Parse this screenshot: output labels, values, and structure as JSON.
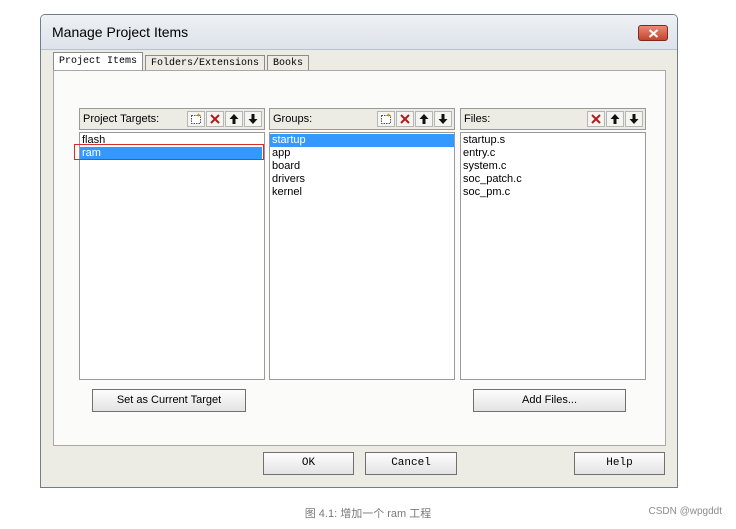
{
  "window": {
    "title": "Manage Project Items"
  },
  "tabs": [
    {
      "label": "Project Items",
      "active": true
    },
    {
      "label": "Folders/Extensions",
      "active": false
    },
    {
      "label": "Books",
      "active": false
    }
  ],
  "targets": {
    "label": "Project Targets:",
    "items": [
      "flash",
      "ram"
    ],
    "selected": "ram"
  },
  "groups": {
    "label": "Groups:",
    "items": [
      "startup",
      "app",
      "board",
      "drivers",
      "kernel"
    ],
    "selected": "startup"
  },
  "files": {
    "label": "Files:",
    "items": [
      "startup.s",
      "entry.c",
      "system.c",
      "soc_patch.c",
      "soc_pm.c"
    ]
  },
  "buttons": {
    "set_current_target": "Set as Current Target",
    "add_files": "Add Files...",
    "ok": "OK",
    "cancel": "Cancel",
    "help": "Help"
  },
  "caption": "图 4.1: 增加一个 ram 工程",
  "watermark": "CSDN @wpgddt",
  "colors": {
    "selection": "#3399ff",
    "highlight_box": "#d62c2c",
    "delete_icon": "#b01e1e"
  },
  "icons": {
    "new": "new-item-icon",
    "delete": "delete-x-icon",
    "up": "arrow-up-icon",
    "down": "arrow-down-icon",
    "close": "close-icon"
  }
}
